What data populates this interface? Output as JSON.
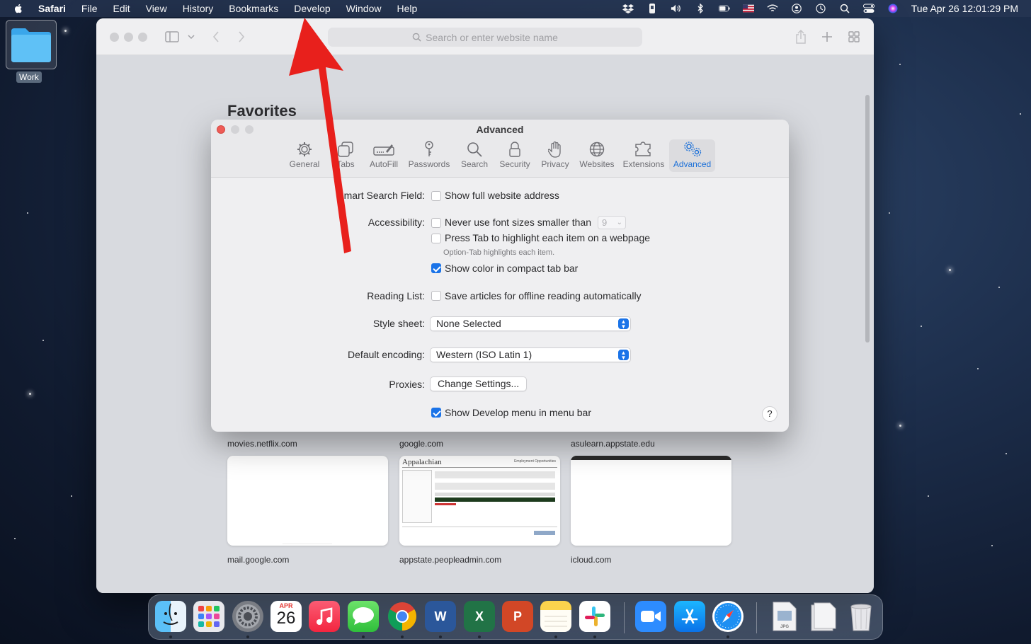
{
  "menubar": {
    "app_name": "Safari",
    "items": [
      "File",
      "Edit",
      "View",
      "History",
      "Bookmarks",
      "Develop",
      "Window",
      "Help"
    ],
    "clock": "Tue Apr 26  12:01:29 PM"
  },
  "desktop": {
    "folder_label": "Work"
  },
  "safari": {
    "address_placeholder": "Search or enter website name",
    "favorites_title": "Favorites",
    "top_sites": [
      "movies.netflix.com",
      "google.com",
      "asulearn.appstate.edu",
      "mail.google.com",
      "appstate.peopleadmin.com",
      "icloud.com"
    ],
    "thumb_appstate": {
      "logo": "Appalachian",
      "heading": "Employment Opportunities"
    }
  },
  "prefs": {
    "title": "Advanced",
    "tabs": [
      "General",
      "Tabs",
      "AutoFill",
      "Passwords",
      "Search",
      "Security",
      "Privacy",
      "Websites",
      "Extensions",
      "Advanced"
    ],
    "active_tab": "Advanced",
    "smart_search": {
      "label": "Smart Search Field:",
      "option": "Show full website address",
      "checked": false
    },
    "accessibility": {
      "label": "Accessibility:",
      "font_option": "Never use font sizes smaller than",
      "font_size": "9",
      "tab_option": "Press Tab to highlight each item on a webpage",
      "tab_hint": "Option-Tab highlights each item.",
      "color_option": "Show color in compact tab bar",
      "color_checked": true
    },
    "reading_list": {
      "label": "Reading List:",
      "option": "Save articles for offline reading automatically",
      "checked": false
    },
    "style_sheet": {
      "label": "Style sheet:",
      "value": "None Selected"
    },
    "encoding": {
      "label": "Default encoding:",
      "value": "Western (ISO Latin 1)"
    },
    "proxies": {
      "label": "Proxies:",
      "button": "Change Settings..."
    },
    "develop": {
      "option": "Show Develop menu in menu bar",
      "checked": true
    },
    "help": "?"
  },
  "dock": {
    "calendar_month": "APR",
    "calendar_day": "26",
    "apps": [
      "Finder",
      "Launchpad",
      "System Preferences",
      "Calendar",
      "Music",
      "Messages",
      "Chrome",
      "Word",
      "Excel",
      "PowerPoint",
      "Notes",
      "Slack",
      "Zoom",
      "App Store",
      "Safari",
      "JPG file",
      "Document",
      "Trash"
    ]
  },
  "colors": {
    "accent": "#1a73e8",
    "annotation_arrow": "#e8201c"
  }
}
